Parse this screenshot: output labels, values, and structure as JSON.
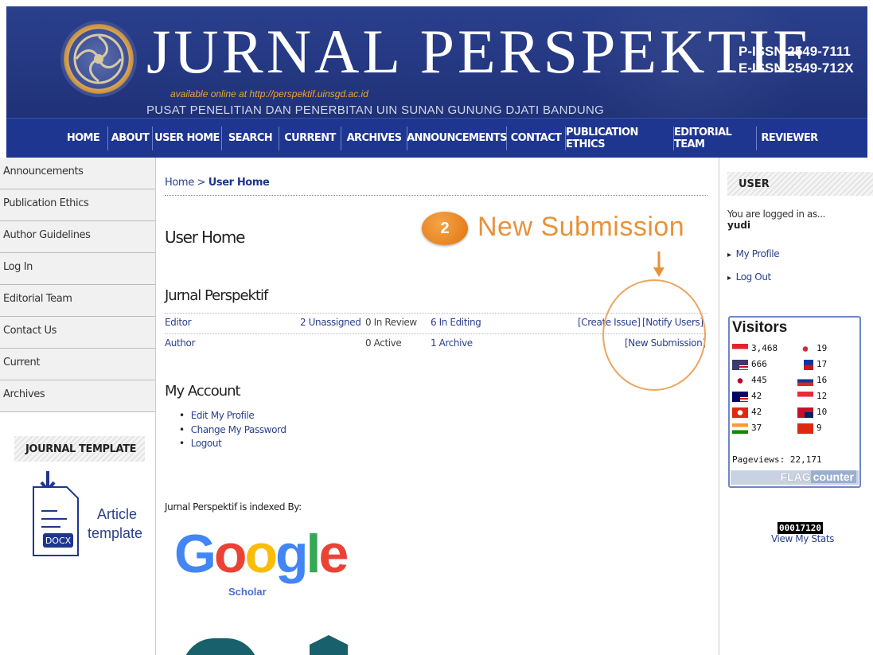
{
  "header": {
    "title": "JURNAL PERSPEKTIF",
    "online": "available online at http://perspektif.uinsgd.ac.id",
    "institution": "PUSAT PENELITIAN DAN PENERBITAN UIN SUNAN GUNUNG DJATI BANDUNG",
    "pissn": "P-ISSN 2549-7111",
    "eissn": "E-ISSN 2549-712X"
  },
  "nav": [
    "HOME",
    "ABOUT",
    "USER HOME",
    "SEARCH",
    "CURRENT",
    "ARCHIVES",
    "ANNOUNCEMENTS",
    "CONTACT",
    "PUBLICATION ETHICS",
    "EDITORIAL TEAM",
    "REVIEWER"
  ],
  "left_menu": [
    "Announcements",
    "Publication Ethics",
    "Author Guidelines",
    "Log In",
    "Editorial Team",
    "Contact Us",
    "Current",
    "Archives"
  ],
  "journal_template": {
    "heading": "JOURNAL TEMPLATE",
    "docx": "DOCX",
    "article": "Article",
    "template": "template"
  },
  "main": {
    "breadcrumb_home": "Home",
    "breadcrumb_sep": ">",
    "breadcrumb_current": "User Home",
    "title": "User Home",
    "journal": "Jurnal Perspektif",
    "editor_row": {
      "role": "Editor",
      "unassigned": "2 Unassigned",
      "in_review": "0 In Review",
      "in_editing": "6 In Editing",
      "create_issue": "[Create Issue]",
      "notify_users": "[Notify Users]"
    },
    "author_row": {
      "role": "Author",
      "active": "0 Active",
      "archive": "1 Archive",
      "new_submission": "[New Submission]"
    },
    "account_title": "My Account",
    "account_links": [
      "Edit My Profile",
      "Change My Password",
      "Logout"
    ],
    "indexed_by": "Jurnal Perspektif is indexed By:",
    "google_letters": [
      "G",
      "o",
      "o",
      "g",
      "l",
      "e"
    ],
    "google_sub": "Scholar"
  },
  "annotation": {
    "step": "2",
    "label": "New Submission"
  },
  "right": {
    "user_heading": "USER",
    "logged_in_as": "You are logged in as...",
    "username": "yudi",
    "my_profile": "My Profile",
    "log_out": "Log Out",
    "visitors_title": "Visitors",
    "visitors_left": [
      {
        "country": "id-flag-icon",
        "count": "3,468"
      },
      {
        "country": "us-flag-icon",
        "count": "666"
      },
      {
        "country": "jp-flag-icon",
        "count": "445"
      },
      {
        "country": "my-flag-icon",
        "count": "42"
      },
      {
        "country": "hk-flag-icon",
        "count": "42"
      },
      {
        "country": "in-flag-icon",
        "count": "37"
      }
    ],
    "visitors_right": [
      {
        "country": "kr-flag-icon",
        "count": "19"
      },
      {
        "country": "ph-flag-icon",
        "count": "17"
      },
      {
        "country": "ru-flag-icon",
        "count": "16"
      },
      {
        "country": "sg-flag-icon",
        "count": "12"
      },
      {
        "country": "au-flag-icon",
        "count": "10"
      },
      {
        "country": "cn-flag-icon",
        "count": "9"
      }
    ],
    "pageviews": "Pageviews: 22,171",
    "flag_word": "FLAG",
    "counter_word": "counter",
    "counter_value": "00017120",
    "view_stats": "View My Stats"
  },
  "colors": {
    "header_blue": "#243781",
    "nav_blue": "#1e3690",
    "annotation_orange": "#e8923a",
    "link_blue": "#2a3f8c"
  }
}
